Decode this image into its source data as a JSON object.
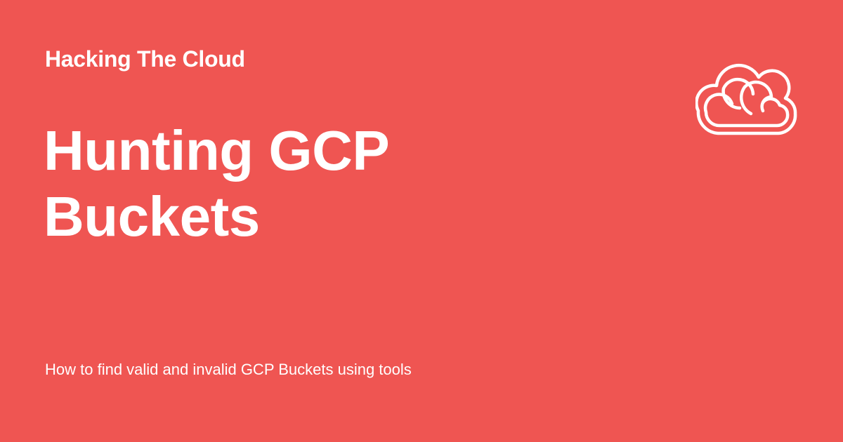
{
  "site": {
    "name": "Hacking The Cloud"
  },
  "title": {
    "line1": "Hunting GCP",
    "line2": "Buckets"
  },
  "description": "How to find valid and invalid GCP Buckets using tools",
  "logo": {
    "icon": "cloud-icon"
  },
  "colors": {
    "background": "#EF5552",
    "text": "#FFFFFF"
  }
}
